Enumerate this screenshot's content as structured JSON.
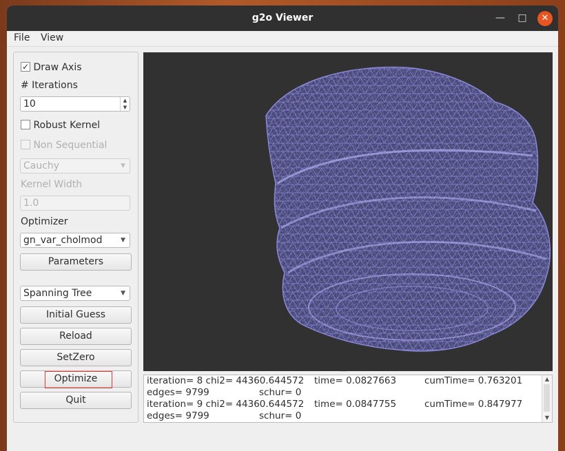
{
  "window": {
    "title": "g2o Viewer",
    "min_icon": "minimize-icon",
    "max_icon": "maximize-icon",
    "close_icon": "close-icon"
  },
  "menu": {
    "file": "File",
    "view": "View"
  },
  "panel": {
    "draw_axis": {
      "label": "Draw Axis",
      "checked": true
    },
    "iterations_label": "# Iterations",
    "iterations_value": "10",
    "robust_kernel": {
      "label": "Robust Kernel",
      "checked": false
    },
    "non_sequential": {
      "label": "Non Sequential",
      "checked": false,
      "disabled": true
    },
    "kernel_select": "Cauchy",
    "kernel_width_label": "Kernel Width",
    "kernel_width_value": "1.0",
    "optimizer_label": "Optimizer",
    "optimizer_select": "gn_var_cholmod",
    "parameters_btn": "Parameters",
    "init_select": "Spanning Tree",
    "initial_guess_btn": "Initial Guess",
    "reload_btn": "Reload",
    "setzero_btn": "SetZero",
    "optimize_btn": "Optimize",
    "quit_btn": "Quit"
  },
  "log": [
    {
      "a": "iteration= 8 chi2= 44360.644572",
      "b": "time= 0.0827663",
      "c": "cumTime= 0.763201"
    },
    {
      "a": "edges= 9799",
      "b": "schur= 0",
      "c": ""
    },
    {
      "a": "iteration= 9 chi2= 44360.644572",
      "b": "time= 0.0847755",
      "c": "cumTime= 0.847977"
    },
    {
      "a": "edges= 9799",
      "b": "schur= 0",
      "c": ""
    }
  ],
  "colors": {
    "accent": "#e95420",
    "mesh": "#8a87d8",
    "viewer_bg": "#313131",
    "annotation": "#e53935"
  }
}
